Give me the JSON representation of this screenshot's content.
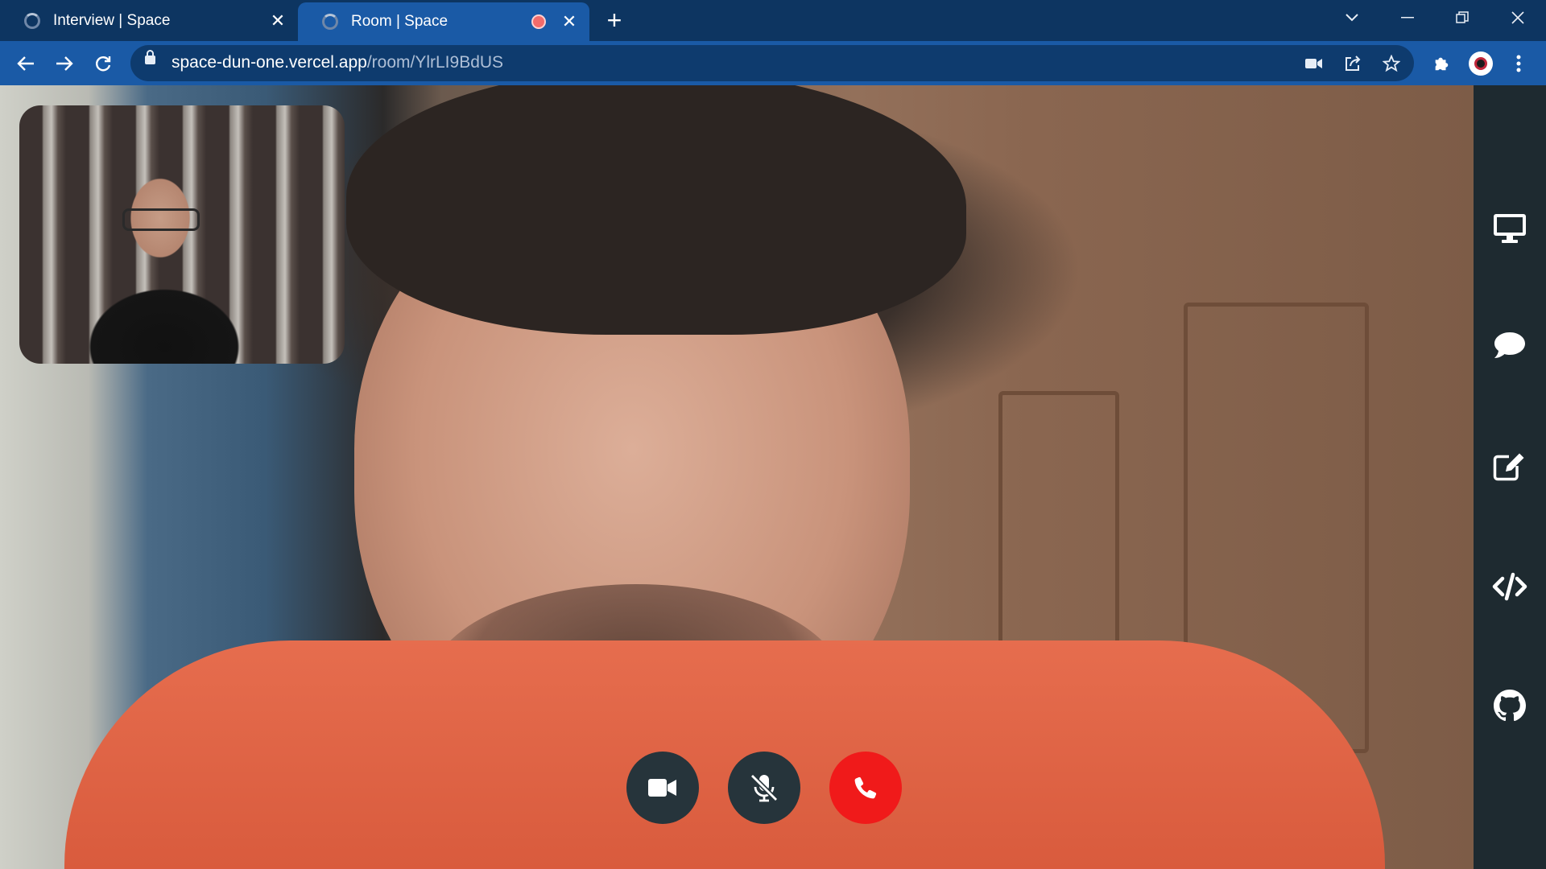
{
  "browser": {
    "tabs": [
      {
        "title": "Interview | Space",
        "active": false
      },
      {
        "title": "Room | Space",
        "active": true,
        "recording": true
      }
    ],
    "new_tab_symbol": "+",
    "address": {
      "host": "space-dun-one.vercel.app",
      "path": "/room/YlrLI9BdUS"
    },
    "window_controls": [
      "tab-search",
      "minimize",
      "restore",
      "close"
    ]
  },
  "call": {
    "controls": [
      {
        "name": "camera",
        "icon": "video-camera-icon",
        "state": "on",
        "color": "#26343b"
      },
      {
        "name": "microphone",
        "icon": "microphone-slash-icon",
        "state": "muted",
        "color": "#26343b"
      },
      {
        "name": "end-call",
        "icon": "phone-icon",
        "color": "#f01a1a"
      }
    ]
  },
  "sidebar": {
    "items": [
      {
        "name": "screen-share",
        "icon": "desktop-icon"
      },
      {
        "name": "chat",
        "icon": "chat-bubble-icon"
      },
      {
        "name": "whiteboard",
        "icon": "edit-icon"
      },
      {
        "name": "code-editor",
        "icon": "code-icon"
      },
      {
        "name": "github",
        "icon": "github-icon"
      }
    ]
  },
  "colors": {
    "tabstrip": "#0d3561",
    "toolbar": "#1a5aa6",
    "sidebar": "#1e2a30",
    "end_call": "#f01a1a"
  }
}
